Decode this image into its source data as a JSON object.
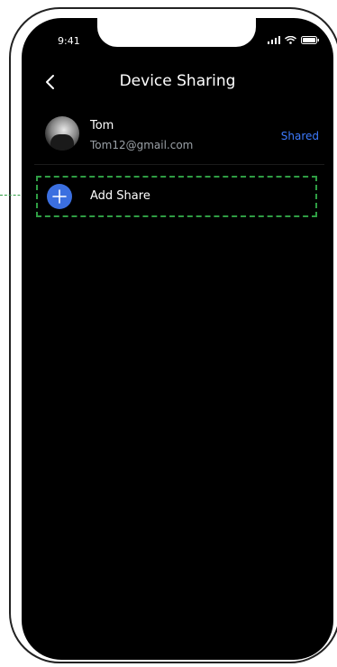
{
  "status_bar": {
    "time": "9:41"
  },
  "header": {
    "title": "Device Sharing"
  },
  "share_list": [
    {
      "name": "Tom",
      "email": "Tom12@gmail.com",
      "status": "Shared"
    }
  ],
  "add_share": {
    "label": "Add Share"
  },
  "colors": {
    "accent": "#3d7bff",
    "add_button": "#3b6fe0",
    "highlight_dash": "#2f9e44"
  }
}
